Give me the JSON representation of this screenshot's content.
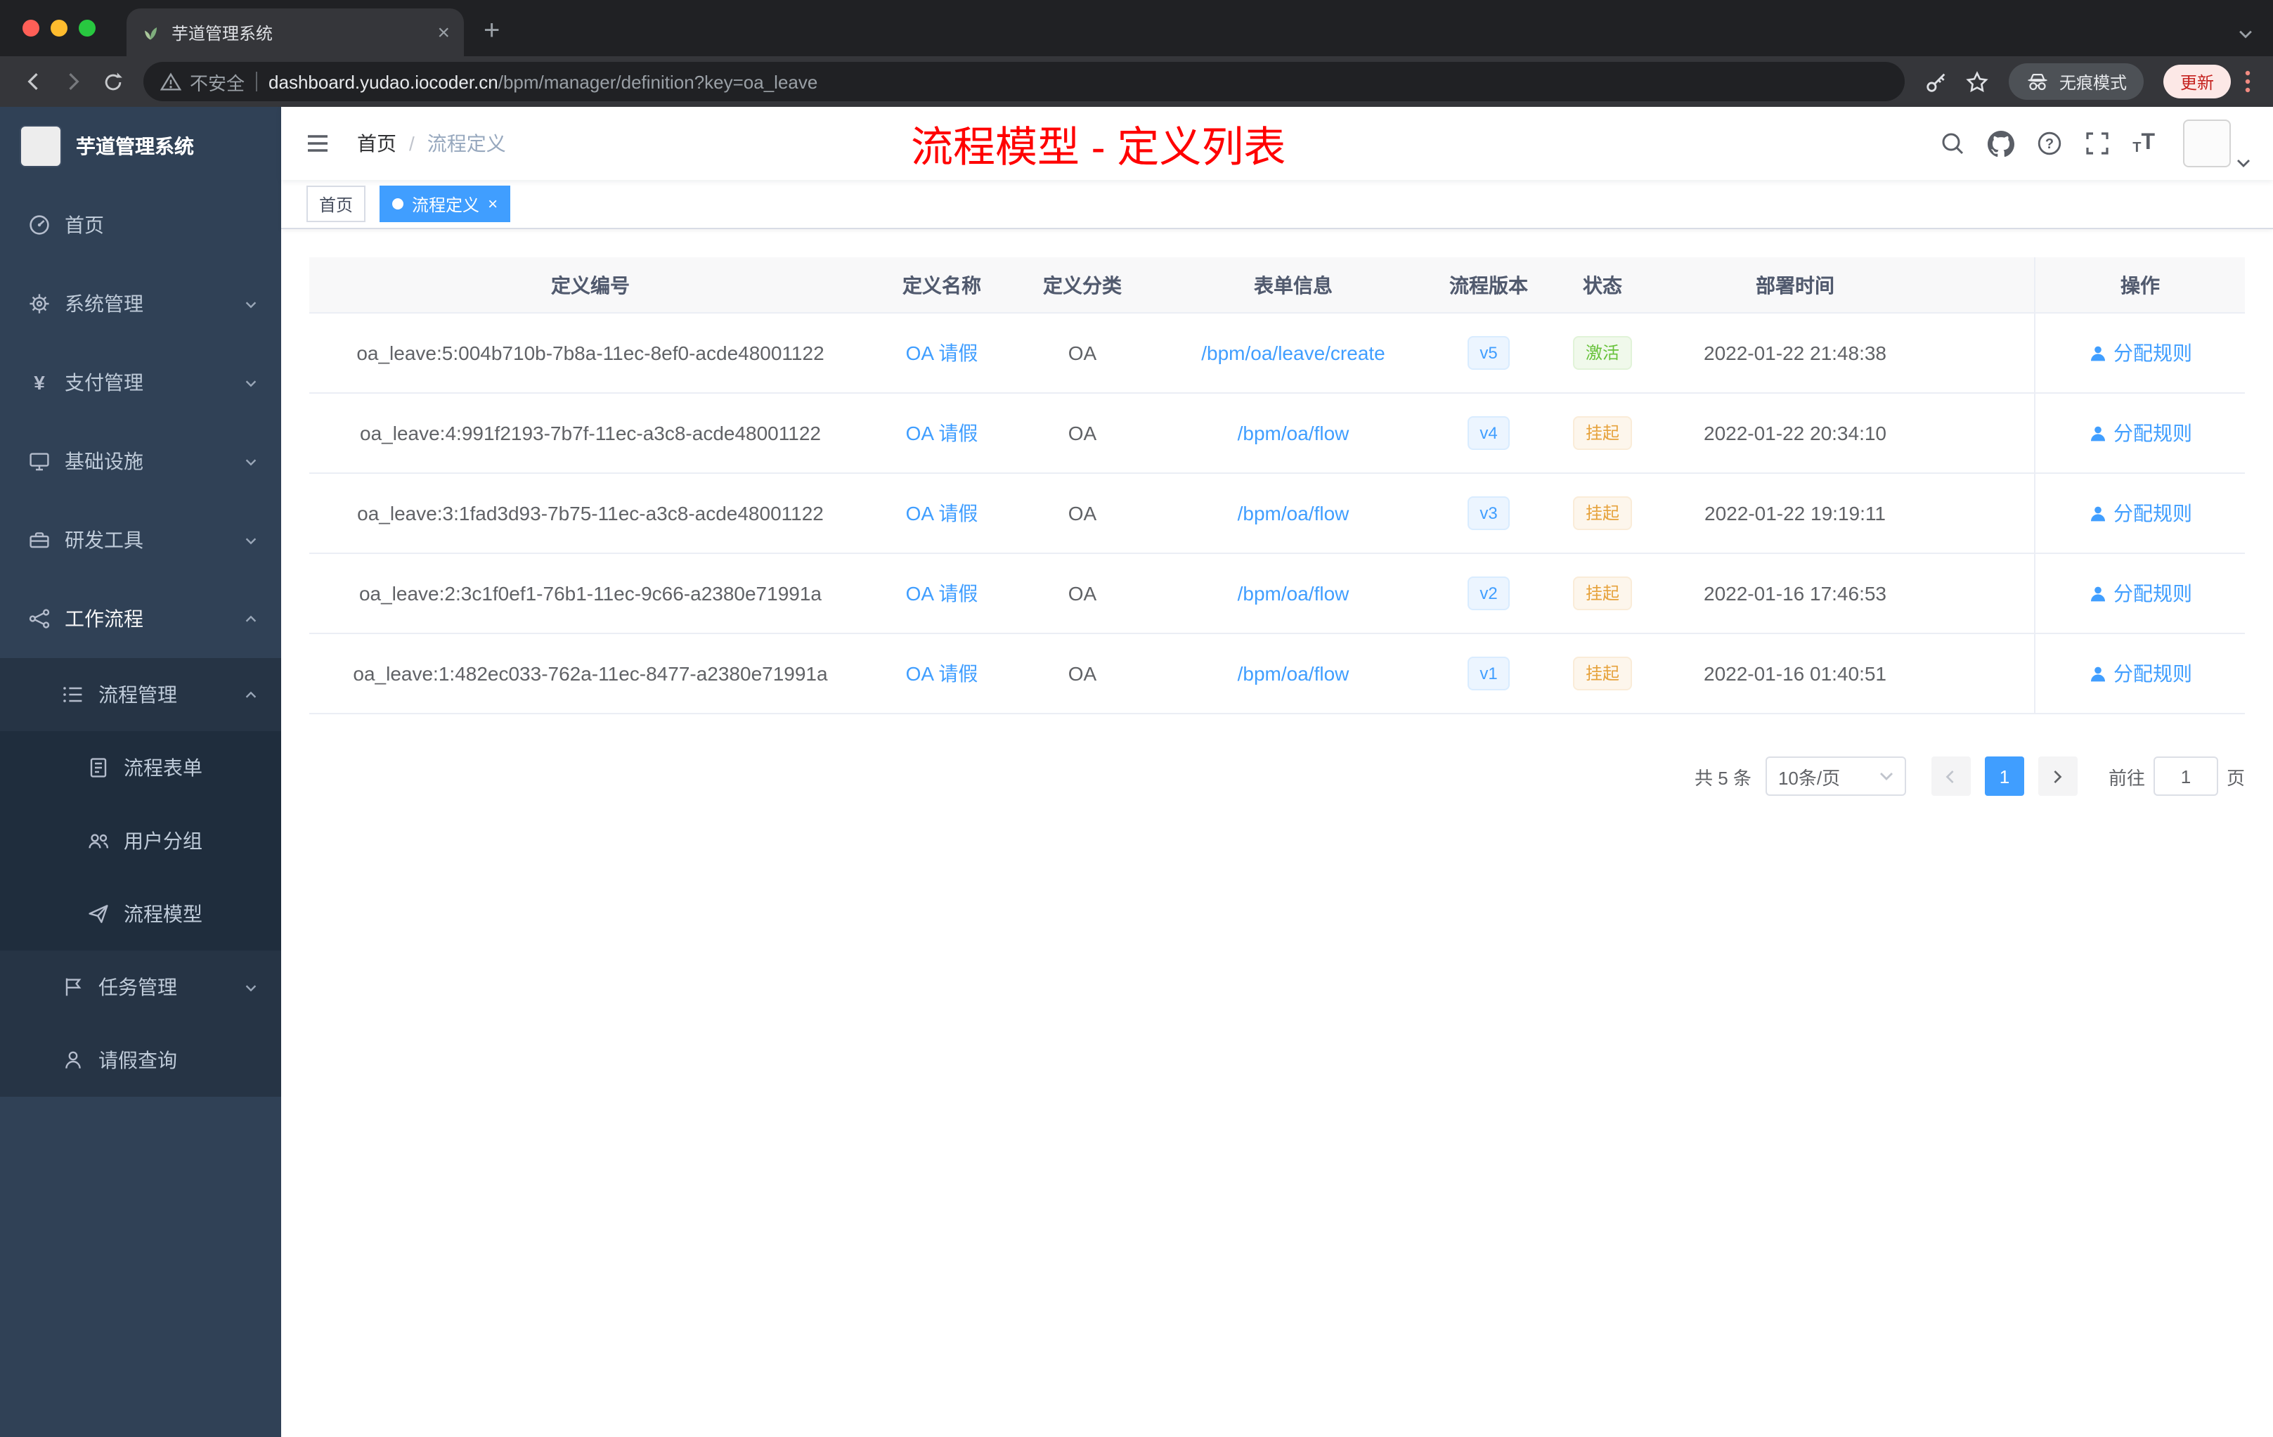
{
  "browser": {
    "tab": {
      "title": "芋道管理系统"
    },
    "security_label": "不安全",
    "url_domain": "dashboard.yudao.iocoder.cn",
    "url_path": "/bpm/manager/definition?key=oa_leave",
    "incognito_label": "无痕模式",
    "update_label": "更新"
  },
  "sidebar": {
    "app_title": "芋道管理系统",
    "items": [
      {
        "label": "首页",
        "icon": "dashboard-icon",
        "level": 1
      },
      {
        "label": "系统管理",
        "icon": "gear-icon",
        "level": 1,
        "expandable": true,
        "expanded": false
      },
      {
        "label": "支付管理",
        "icon": "yen-icon",
        "level": 1,
        "expandable": true,
        "expanded": false
      },
      {
        "label": "基础设施",
        "icon": "infrastructure-icon",
        "level": 1,
        "expandable": true,
        "expanded": false
      },
      {
        "label": "研发工具",
        "icon": "toolbox-icon",
        "level": 1,
        "expandable": true,
        "expanded": false
      },
      {
        "label": "工作流程",
        "icon": "workflow-icon",
        "level": 1,
        "expandable": true,
        "expanded": true,
        "active": true
      },
      {
        "label": "流程管理",
        "icon": "process-list-icon",
        "level": 2,
        "expandable": true,
        "expanded": true
      },
      {
        "label": "流程表单",
        "icon": "form-icon",
        "level": 3
      },
      {
        "label": "用户分组",
        "icon": "user-group-icon",
        "level": 3
      },
      {
        "label": "流程模型",
        "icon": "paper-plane-icon",
        "level": 3
      },
      {
        "label": "任务管理",
        "icon": "flag-icon",
        "level": 2,
        "expandable": true,
        "expanded": false
      },
      {
        "label": "请假查询",
        "icon": "person-icon",
        "level": 2
      }
    ]
  },
  "header": {
    "breadcrumb": {
      "home": "首页",
      "separator": "/",
      "current": "流程定义"
    },
    "annotation": "流程模型 - 定义列表",
    "icons": [
      "search-icon",
      "github-icon",
      "question-icon",
      "fullscreen-icon",
      "font-size-icon"
    ]
  },
  "tags": {
    "items": [
      {
        "label": "首页",
        "active": false
      },
      {
        "label": "流程定义",
        "active": true
      }
    ]
  },
  "table": {
    "columns": [
      "定义编号",
      "定义名称",
      "定义分类",
      "表单信息",
      "流程版本",
      "状态",
      "部署时间",
      "操作"
    ],
    "rows": [
      {
        "id": "oa_leave:5:004b710b-7b8a-11ec-8ef0-acde48001122",
        "name": "OA 请假",
        "category": "OA",
        "form": "/bpm/oa/leave/create",
        "version": "v5",
        "status": "激活",
        "status_type": "success",
        "time": "2022-01-22 21:48:38",
        "action": "分配规则"
      },
      {
        "id": "oa_leave:4:991f2193-7b7f-11ec-a3c8-acde48001122",
        "name": "OA 请假",
        "category": "OA",
        "form": "/bpm/oa/flow",
        "version": "v4",
        "status": "挂起",
        "status_type": "warning",
        "time": "2022-01-22 20:34:10",
        "action": "分配规则"
      },
      {
        "id": "oa_leave:3:1fad3d93-7b75-11ec-a3c8-acde48001122",
        "name": "OA 请假",
        "category": "OA",
        "form": "/bpm/oa/flow",
        "version": "v3",
        "status": "挂起",
        "status_type": "warning",
        "time": "2022-01-22 19:19:11",
        "action": "分配规则"
      },
      {
        "id": "oa_leave:2:3c1f0ef1-76b1-11ec-9c66-a2380e71991a",
        "name": "OA 请假",
        "category": "OA",
        "form": "/bpm/oa/flow",
        "version": "v2",
        "status": "挂起",
        "status_type": "warning",
        "time": "2022-01-16 17:46:53",
        "action": "分配规则"
      },
      {
        "id": "oa_leave:1:482ec033-762a-11ec-8477-a2380e71991a",
        "name": "OA 请假",
        "category": "OA",
        "form": "/bpm/oa/flow",
        "version": "v1",
        "status": "挂起",
        "status_type": "warning",
        "time": "2022-01-16 01:40:51",
        "action": "分配规则"
      }
    ]
  },
  "pagination": {
    "total": "共 5 条",
    "page_size": "10条/页",
    "page": "1",
    "goto_label": "前往",
    "goto_value": "1",
    "unit_label": "页"
  },
  "colors": {
    "accent": "#409eff",
    "sidebar_bg": "#304156",
    "annotation_red": "#ff0000",
    "status_success": "#67c23a",
    "status_warning": "#e6a23c"
  }
}
